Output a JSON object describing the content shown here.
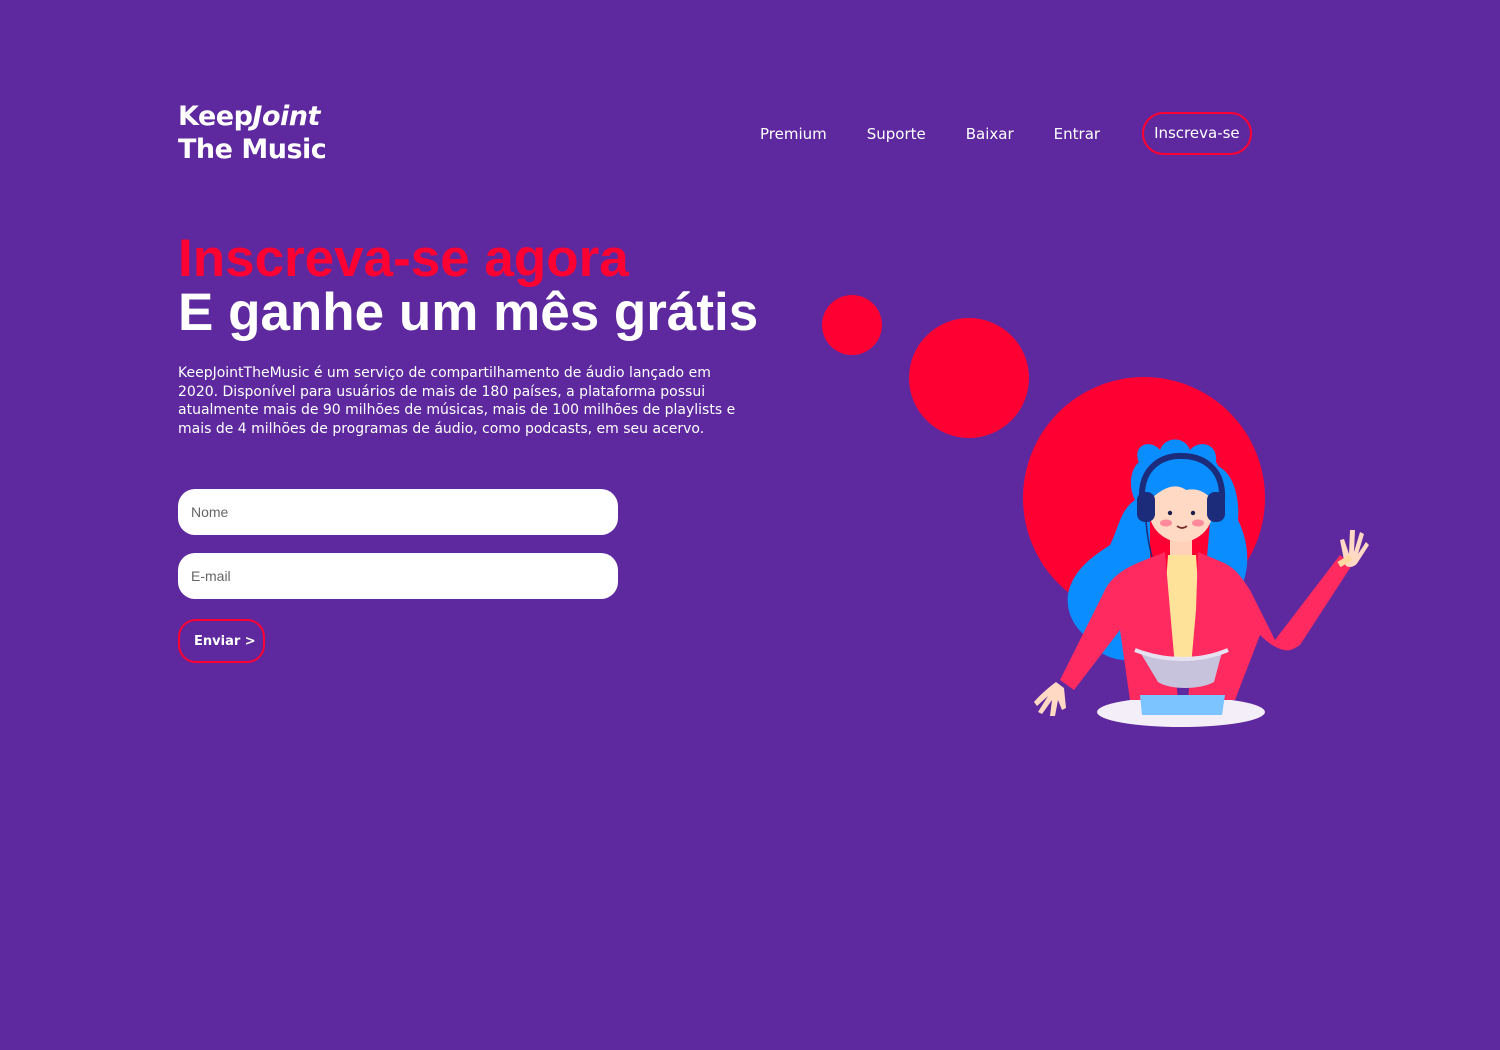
{
  "brand": {
    "line1_regular": "Keep",
    "line1_italic": "Joint",
    "line2": "The Music"
  },
  "nav": {
    "items": [
      "Premium",
      "Suporte",
      "Baixar",
      "Entrar"
    ],
    "cta": "Inscreva-se"
  },
  "hero": {
    "headline_highlight": "Inscreva-se agora",
    "headline": "E ganhe um mês grátis",
    "description": "KeepJointTheMusic é um serviço de compartilhamento de áudio lançado em 2020. Disponível para usuários de mais de 180 países, a plataforma possui atualmente mais de 90 milhões de músicas, mais de 100 milhões de playlists e mais de 4 milhões de programas de áudio, como podcasts, em seu acervo."
  },
  "form": {
    "name_placeholder": "Nome",
    "email_placeholder": "E-mail",
    "submit_label": "Enviar >"
  },
  "colors": {
    "background": "#5e289e",
    "accent": "#ff0033",
    "text": "#ffffff"
  },
  "illustration": {
    "icon": "woman-with-headphones-illustration"
  }
}
